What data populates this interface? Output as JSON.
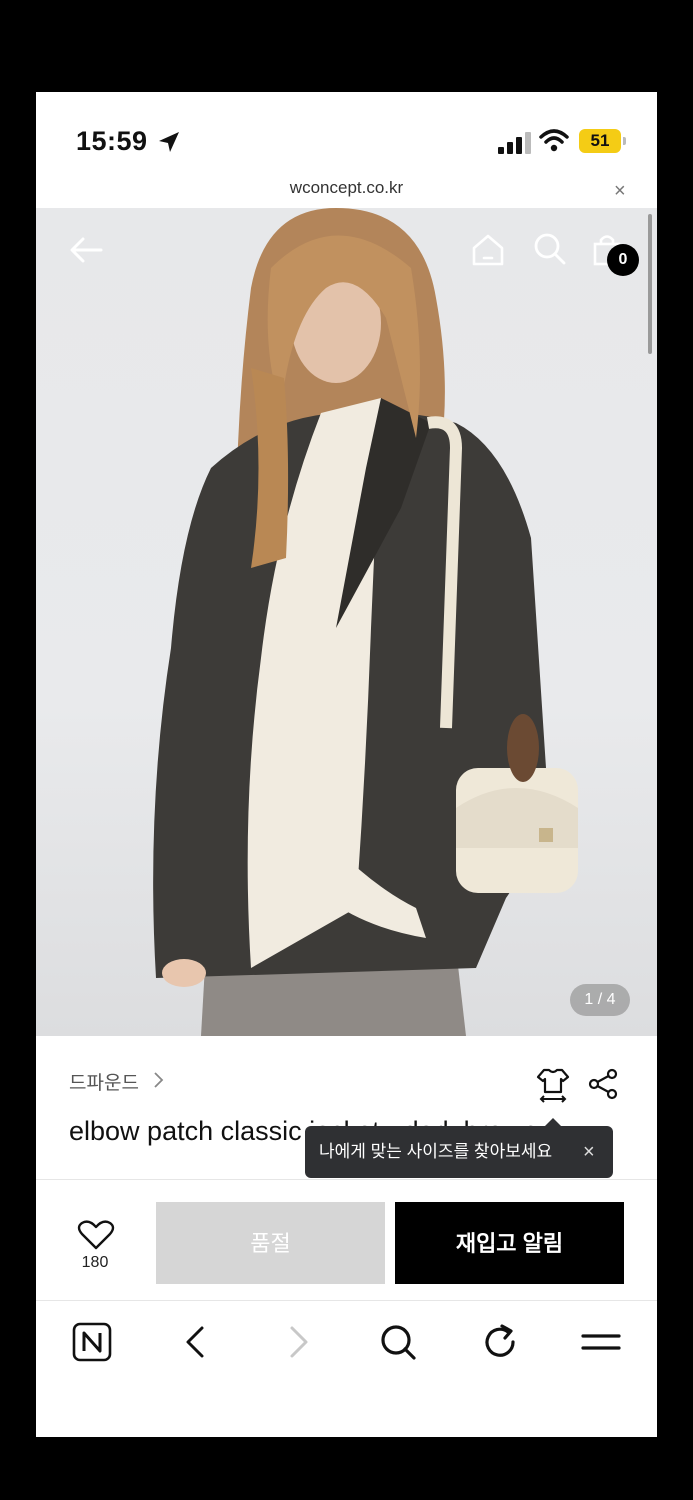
{
  "status_bar": {
    "time": "15:59",
    "battery": "51"
  },
  "browser": {
    "url": "wconcept.co.kr",
    "close": "×"
  },
  "header": {
    "cart_count": "0"
  },
  "gallery": {
    "counter": "1 / 4"
  },
  "product": {
    "brand": "드파운드",
    "title": "elbow patch classic jacket - dark brown"
  },
  "tooltip": {
    "text": "나에게 맞는 사이즈를 찾아보세요",
    "close": "×"
  },
  "buy_bar": {
    "wish_count": "180",
    "soldout_label": "품절",
    "restock_label": "재입고 알림"
  },
  "colors": {
    "accent_battery": "#f4cc15",
    "primary_button": "#000000",
    "disabled_button": "#d6d6d6"
  },
  "icons": [
    "location-arrow-icon",
    "signal-icon",
    "wifi-icon",
    "back-arrow-icon",
    "home-icon",
    "search-icon",
    "shopping-bag-icon",
    "size-guide-icon",
    "share-icon",
    "heart-icon",
    "naver-icon",
    "reload-icon",
    "menu-icon"
  ]
}
